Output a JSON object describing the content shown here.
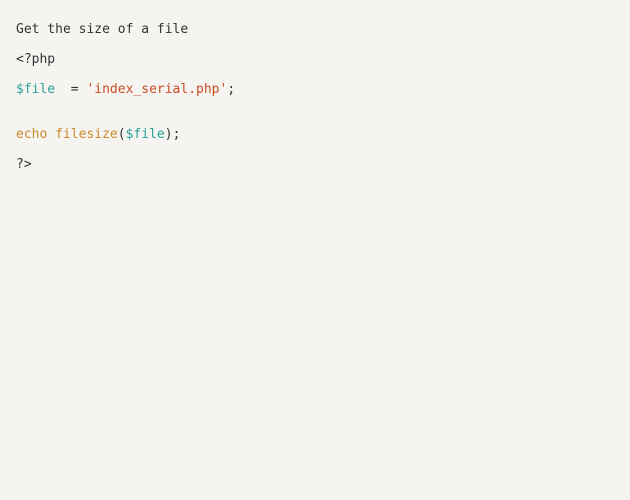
{
  "code": {
    "line1": {
      "comment": "Get the size of a file"
    },
    "line2": {
      "open_tag": "<?php"
    },
    "line3": {
      "var": "$file",
      "gap": "  ",
      "eq": "=",
      "sp": " ",
      "str": "'index_serial.php'",
      "semi": ";"
    },
    "line4": {
      "blank": ""
    },
    "line5": {
      "echo": "echo",
      "sp1": " ",
      "func": "filesize",
      "lp": "(",
      "arg": "$file",
      "rp": ")",
      "semi": ";"
    },
    "line6": {
      "close_tag": "?>"
    }
  }
}
